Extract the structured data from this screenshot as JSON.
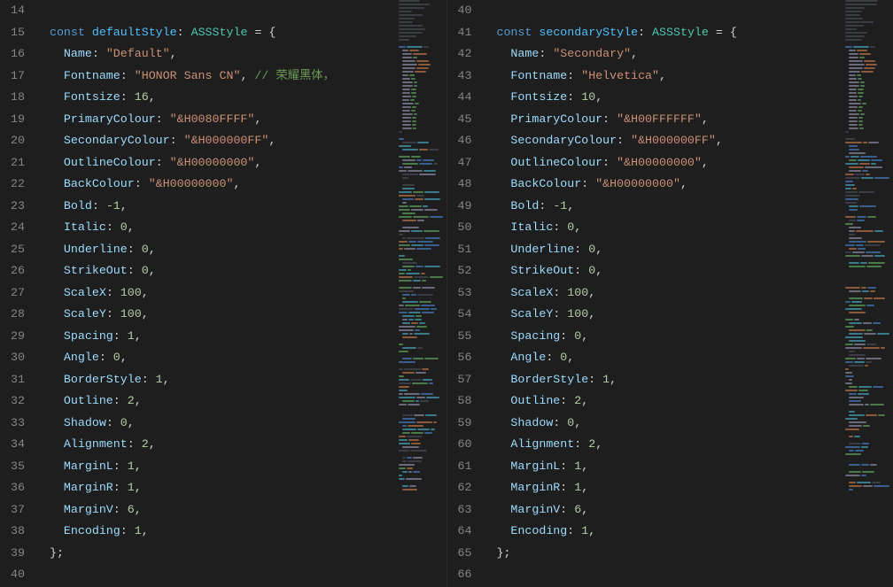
{
  "left": {
    "startLine": 14,
    "code": [
      {
        "indent": 0,
        "type": "blank"
      },
      {
        "indent": 0,
        "type": "decl",
        "keyword": "const",
        "name": "defaultStyle",
        "typeAnn": "ASSStyle",
        "open": "{"
      },
      {
        "indent": 1,
        "type": "kv",
        "key": "Name",
        "val": "\"Default\"",
        "valKind": "string"
      },
      {
        "indent": 1,
        "type": "kv",
        "key": "Fontname",
        "val": "\"HONOR Sans CN\"",
        "valKind": "string",
        "comment": "// 荣耀黑体，"
      },
      {
        "indent": 1,
        "type": "kv",
        "key": "Fontsize",
        "val": "16",
        "valKind": "num"
      },
      {
        "indent": 1,
        "type": "kv",
        "key": "PrimaryColour",
        "val": "\"&H0080FFFF\"",
        "valKind": "string"
      },
      {
        "indent": 1,
        "type": "kv",
        "key": "SecondaryColour",
        "val": "\"&H000000FF\"",
        "valKind": "string"
      },
      {
        "indent": 1,
        "type": "kv",
        "key": "OutlineColour",
        "val": "\"&H00000000\"",
        "valKind": "string"
      },
      {
        "indent": 1,
        "type": "kv",
        "key": "BackColour",
        "val": "\"&H00000000\"",
        "valKind": "string"
      },
      {
        "indent": 1,
        "type": "kv",
        "key": "Bold",
        "val": "-1",
        "valKind": "num"
      },
      {
        "indent": 1,
        "type": "kv",
        "key": "Italic",
        "val": "0",
        "valKind": "num"
      },
      {
        "indent": 1,
        "type": "kv",
        "key": "Underline",
        "val": "0",
        "valKind": "num"
      },
      {
        "indent": 1,
        "type": "kv",
        "key": "StrikeOut",
        "val": "0",
        "valKind": "num"
      },
      {
        "indent": 1,
        "type": "kv",
        "key": "ScaleX",
        "val": "100",
        "valKind": "num"
      },
      {
        "indent": 1,
        "type": "kv",
        "key": "ScaleY",
        "val": "100",
        "valKind": "num"
      },
      {
        "indent": 1,
        "type": "kv",
        "key": "Spacing",
        "val": "1",
        "valKind": "num"
      },
      {
        "indent": 1,
        "type": "kv",
        "key": "Angle",
        "val": "0",
        "valKind": "num"
      },
      {
        "indent": 1,
        "type": "kv",
        "key": "BorderStyle",
        "val": "1",
        "valKind": "num"
      },
      {
        "indent": 1,
        "type": "kv",
        "key": "Outline",
        "val": "2",
        "valKind": "num"
      },
      {
        "indent": 1,
        "type": "kv",
        "key": "Shadow",
        "val": "0",
        "valKind": "num"
      },
      {
        "indent": 1,
        "type": "kv",
        "key": "Alignment",
        "val": "2",
        "valKind": "num"
      },
      {
        "indent": 1,
        "type": "kv",
        "key": "MarginL",
        "val": "1",
        "valKind": "num"
      },
      {
        "indent": 1,
        "type": "kv",
        "key": "MarginR",
        "val": "1",
        "valKind": "num"
      },
      {
        "indent": 1,
        "type": "kv",
        "key": "MarginV",
        "val": "6",
        "valKind": "num"
      },
      {
        "indent": 1,
        "type": "kv",
        "key": "Encoding",
        "val": "1",
        "valKind": "num"
      },
      {
        "indent": 0,
        "type": "close",
        "text": "};"
      },
      {
        "indent": 0,
        "type": "blank"
      }
    ]
  },
  "right": {
    "startLine": 40,
    "code": [
      {
        "indent": 0,
        "type": "blank"
      },
      {
        "indent": 0,
        "type": "decl",
        "keyword": "const",
        "name": "secondaryStyle",
        "typeAnn": "ASSStyle",
        "open": "{"
      },
      {
        "indent": 1,
        "type": "kv",
        "key": "Name",
        "val": "\"Secondary\"",
        "valKind": "string"
      },
      {
        "indent": 1,
        "type": "kv",
        "key": "Fontname",
        "val": "\"Helvetica\"",
        "valKind": "string"
      },
      {
        "indent": 1,
        "type": "kv",
        "key": "Fontsize",
        "val": "10",
        "valKind": "num"
      },
      {
        "indent": 1,
        "type": "kv",
        "key": "PrimaryColour",
        "val": "\"&H00FFFFFF\"",
        "valKind": "string"
      },
      {
        "indent": 1,
        "type": "kv",
        "key": "SecondaryColour",
        "val": "\"&H000000FF\"",
        "valKind": "string"
      },
      {
        "indent": 1,
        "type": "kv",
        "key": "OutlineColour",
        "val": "\"&H00000000\"",
        "valKind": "string"
      },
      {
        "indent": 1,
        "type": "kv",
        "key": "BackColour",
        "val": "\"&H00000000\"",
        "valKind": "string"
      },
      {
        "indent": 1,
        "type": "kv",
        "key": "Bold",
        "val": "-1",
        "valKind": "num"
      },
      {
        "indent": 1,
        "type": "kv",
        "key": "Italic",
        "val": "0",
        "valKind": "num"
      },
      {
        "indent": 1,
        "type": "kv",
        "key": "Underline",
        "val": "0",
        "valKind": "num"
      },
      {
        "indent": 1,
        "type": "kv",
        "key": "StrikeOut",
        "val": "0",
        "valKind": "num"
      },
      {
        "indent": 1,
        "type": "kv",
        "key": "ScaleX",
        "val": "100",
        "valKind": "num"
      },
      {
        "indent": 1,
        "type": "kv",
        "key": "ScaleY",
        "val": "100",
        "valKind": "num"
      },
      {
        "indent": 1,
        "type": "kv",
        "key": "Spacing",
        "val": "0",
        "valKind": "num"
      },
      {
        "indent": 1,
        "type": "kv",
        "key": "Angle",
        "val": "0",
        "valKind": "num"
      },
      {
        "indent": 1,
        "type": "kv",
        "key": "BorderStyle",
        "val": "1",
        "valKind": "num"
      },
      {
        "indent": 1,
        "type": "kv",
        "key": "Outline",
        "val": "2",
        "valKind": "num"
      },
      {
        "indent": 1,
        "type": "kv",
        "key": "Shadow",
        "val": "0",
        "valKind": "num"
      },
      {
        "indent": 1,
        "type": "kv",
        "key": "Alignment",
        "val": "2",
        "valKind": "num"
      },
      {
        "indent": 1,
        "type": "kv",
        "key": "MarginL",
        "val": "1",
        "valKind": "num"
      },
      {
        "indent": 1,
        "type": "kv",
        "key": "MarginR",
        "val": "1",
        "valKind": "num"
      },
      {
        "indent": 1,
        "type": "kv",
        "key": "MarginV",
        "val": "6",
        "valKind": "num"
      },
      {
        "indent": 1,
        "type": "kv",
        "key": "Encoding",
        "val": "1",
        "valKind": "num"
      },
      {
        "indent": 0,
        "type": "close",
        "text": "};"
      },
      {
        "indent": 0,
        "type": "blank"
      }
    ]
  }
}
